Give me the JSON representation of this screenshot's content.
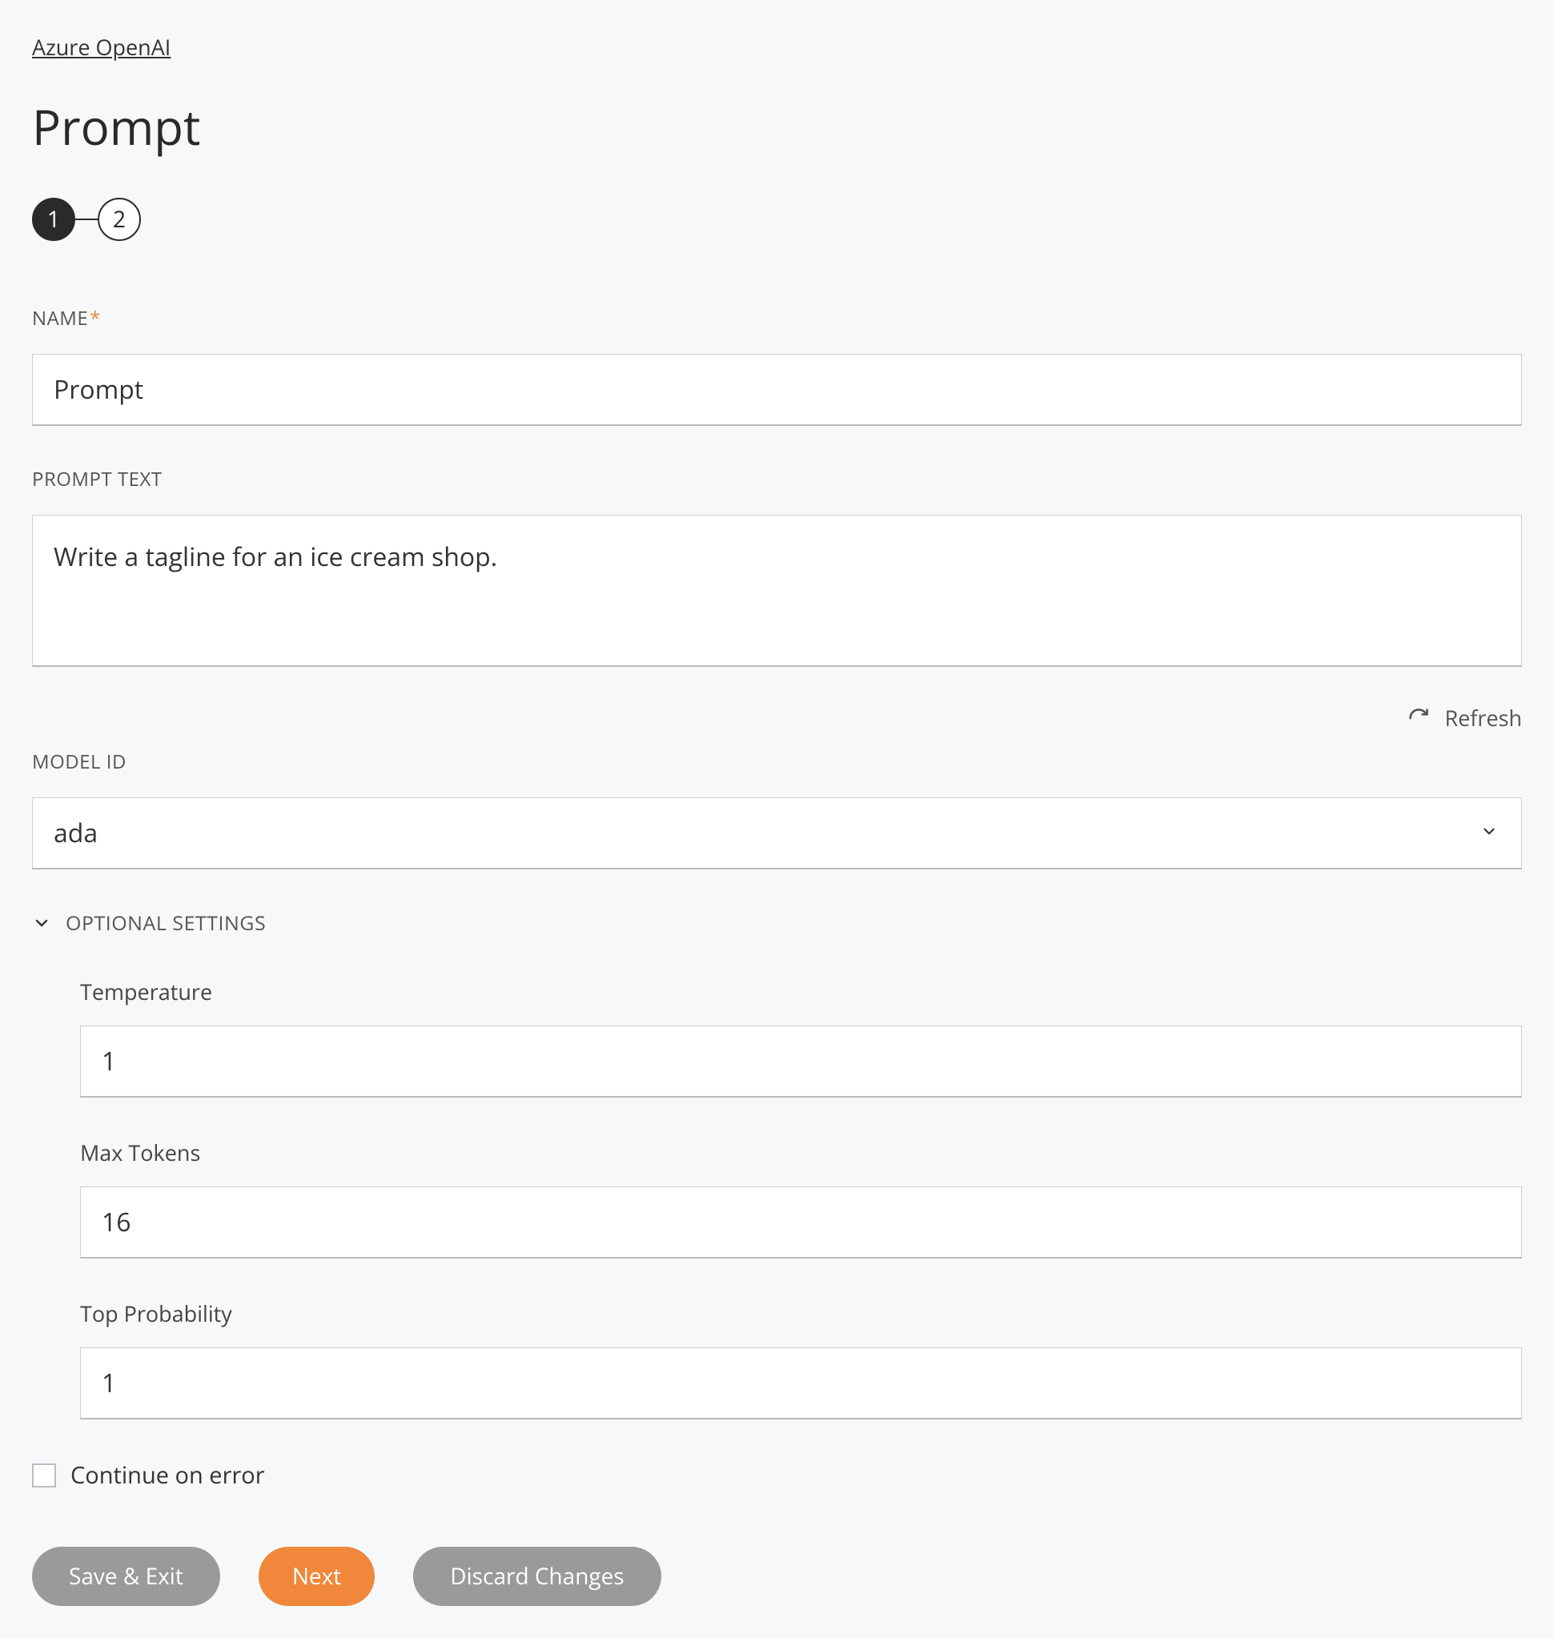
{
  "breadcrumb": {
    "label": "Azure OpenAI"
  },
  "page_title": "Prompt",
  "stepper": {
    "steps": [
      "1",
      "2"
    ],
    "active_index": 0
  },
  "fields": {
    "name": {
      "label": "NAME",
      "required": true,
      "value": "Prompt"
    },
    "prompt_text": {
      "label": "PROMPT TEXT",
      "value": "Write a tagline for an ice cream shop."
    },
    "model_id": {
      "label": "MODEL ID",
      "value": "ada",
      "refresh_label": "Refresh"
    }
  },
  "optional": {
    "header": "OPTIONAL SETTINGS",
    "expanded": true,
    "temperature": {
      "label": "Temperature",
      "value": "1"
    },
    "max_tokens": {
      "label": "Max Tokens",
      "value": "16"
    },
    "top_probability": {
      "label": "Top Probability",
      "value": "1"
    }
  },
  "continue_on_error": {
    "label": "Continue on error",
    "checked": false
  },
  "buttons": {
    "save_exit": "Save & Exit",
    "next": "Next",
    "discard": "Discard Changes"
  }
}
